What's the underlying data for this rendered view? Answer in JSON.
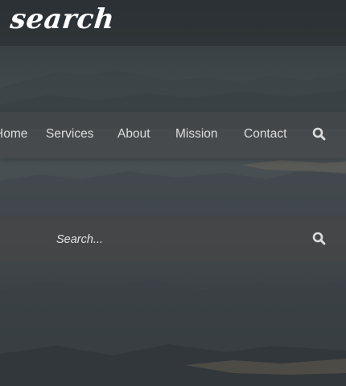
{
  "header": {
    "logo": "search"
  },
  "nav": {
    "items": [
      {
        "label": "Home"
      },
      {
        "label": "Services"
      },
      {
        "label": "About"
      },
      {
        "label": "Mission"
      },
      {
        "label": "Contact"
      }
    ],
    "search_icon": "search-icon"
  },
  "search": {
    "placeholder": "Search...",
    "value": "",
    "submit_icon": "search-icon"
  },
  "colors": {
    "text": "#dcdcdc",
    "bar": "#464849",
    "background": "#40464a"
  }
}
